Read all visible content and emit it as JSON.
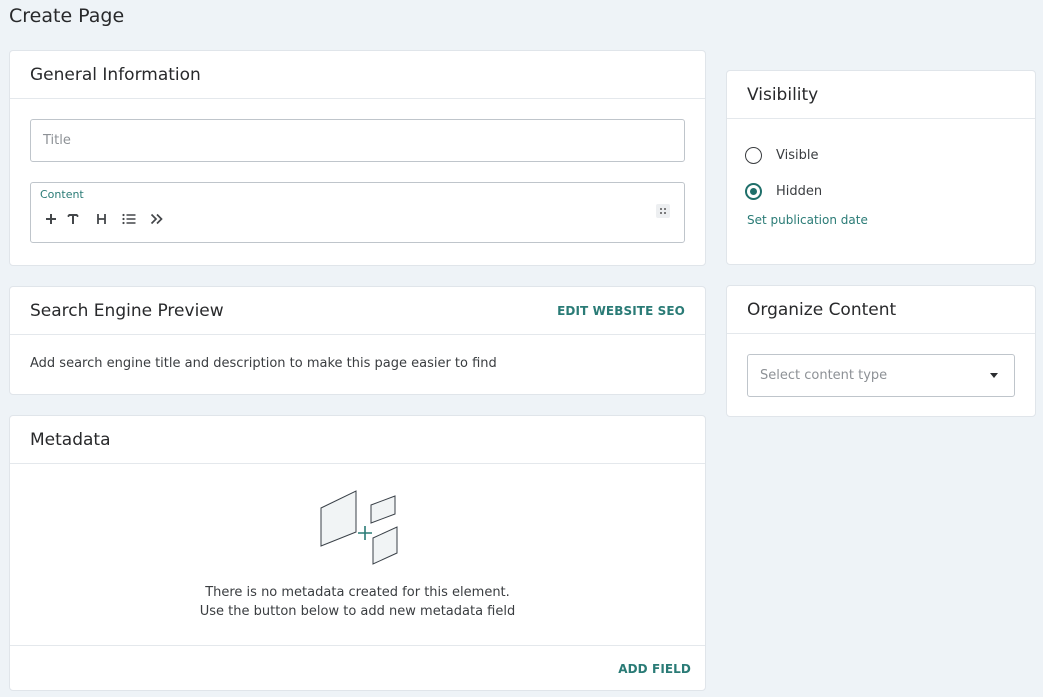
{
  "page": {
    "title": "Create Page"
  },
  "general": {
    "title": "General Information",
    "title_placeholder": "Title",
    "content_label": "Content",
    "toolbar_icons": [
      "plus-icon",
      "text-icon",
      "heading-icon",
      "list-icon",
      "double-chevron-icon"
    ]
  },
  "seo": {
    "title": "Search Engine Preview",
    "edit_link": "EDIT WEBSITE SEO",
    "description": "Add search engine title and description to make this page easier to find"
  },
  "metadata": {
    "title": "Metadata",
    "empty_line1": "There is no metadata created for this element.",
    "empty_line2": "Use the button below to add new metadata field",
    "add_field": "ADD FIELD"
  },
  "visibility": {
    "title": "Visibility",
    "options": [
      {
        "label": "Visible",
        "selected": false
      },
      {
        "label": "Hidden",
        "selected": true
      }
    ],
    "publication_link": "Set publication date"
  },
  "organize": {
    "title": "Organize Content",
    "select_placeholder": "Select content type"
  },
  "colors": {
    "accent": "#2a7b76",
    "background": "#eef3f7"
  }
}
